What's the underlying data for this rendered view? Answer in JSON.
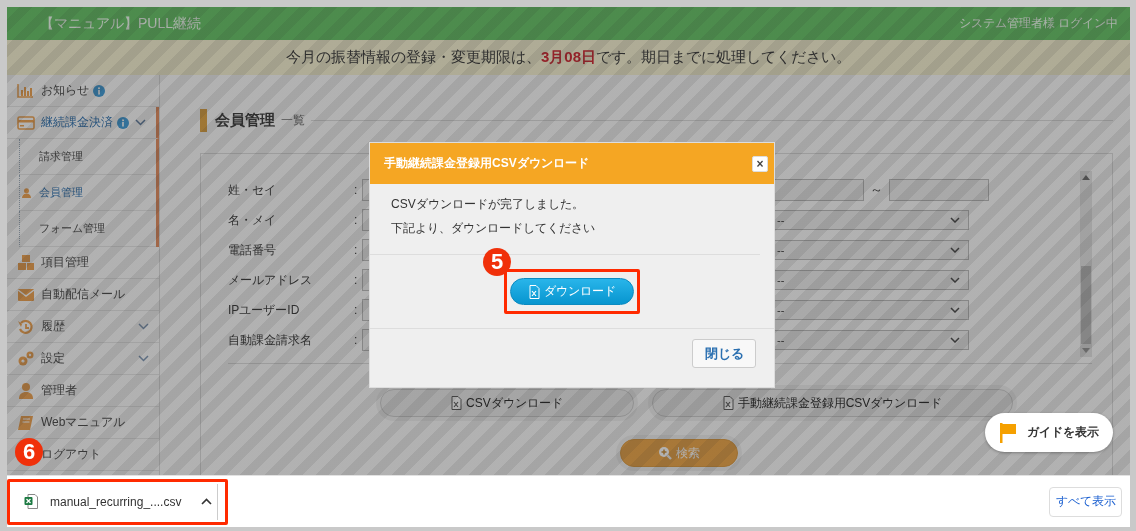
{
  "header": {
    "title": "【マニュアル】PULL継続",
    "user": "システム管理者様 ログイン中"
  },
  "notice": "今月の振替情報の登録・変更期限は、**3月08日**です。期日までに処理してください。",
  "sidebar": {
    "items": [
      {
        "label": "お知らせ",
        "info": true,
        "selected": false
      },
      {
        "label": "継続課金決済",
        "info": true,
        "selected": true,
        "expanded": true,
        "children": [
          {
            "label": "請求管理",
            "selected": false
          },
          {
            "label": "会員管理",
            "selected": true
          },
          {
            "label": "フォーム管理",
            "selected": false
          }
        ]
      },
      {
        "label": "項目管理",
        "selected": false
      },
      {
        "label": "自動配信メール",
        "selected": false
      },
      {
        "label": "履歴",
        "selected": false,
        "expanded": false
      },
      {
        "label": "設定",
        "selected": false,
        "expanded": false
      },
      {
        "label": "管理者",
        "selected": false
      },
      {
        "label": "Webマニュアル",
        "selected": false
      },
      {
        "label": "ログアウト",
        "selected": false
      }
    ]
  },
  "page_title": {
    "title": "会員管理",
    "subtitle": "一覧"
  },
  "search_form": {
    "fields": [
      {
        "label": "姓・セイ",
        "colon": ":",
        "right": {
          "kind": "range",
          "separator": "～"
        }
      },
      {
        "label": "名・メイ",
        "colon": ":",
        "right": {
          "kind": "select",
          "value": "--"
        }
      },
      {
        "label": "電話番号",
        "colon": ":",
        "right": {
          "kind": "select",
          "value": "--"
        }
      },
      {
        "label": "メールアドレス",
        "colon": ":",
        "right": {
          "kind": "select",
          "value": "--"
        }
      },
      {
        "label": "IPユーザーID",
        "colon": ":",
        "right": {
          "kind": "select",
          "value": "--"
        }
      },
      {
        "label": "自動課金請求名",
        "colon": ":",
        "right": {
          "kind": "select",
          "value": "--"
        }
      }
    ]
  },
  "actions": [
    {
      "label": "CSVダウンロード"
    },
    {
      "label": "手動継続課金登録用CSVダウンロード"
    }
  ],
  "search_button": "検索",
  "guide_button": "ガイドを表示",
  "modal": {
    "title": "手動継続課金登録用CSVダウンロード",
    "close": "×",
    "lines": [
      "CSVダウンロードが完了しました。",
      "下記より、ダウンロードしてください"
    ],
    "download_button": "ダウンロード",
    "close_button": "閉じる"
  },
  "annotations": [
    {
      "number": "5"
    },
    {
      "number": "6"
    }
  ],
  "download_bar": {
    "file": "manual_recurring_....csv",
    "show_all": "すべて表示"
  }
}
